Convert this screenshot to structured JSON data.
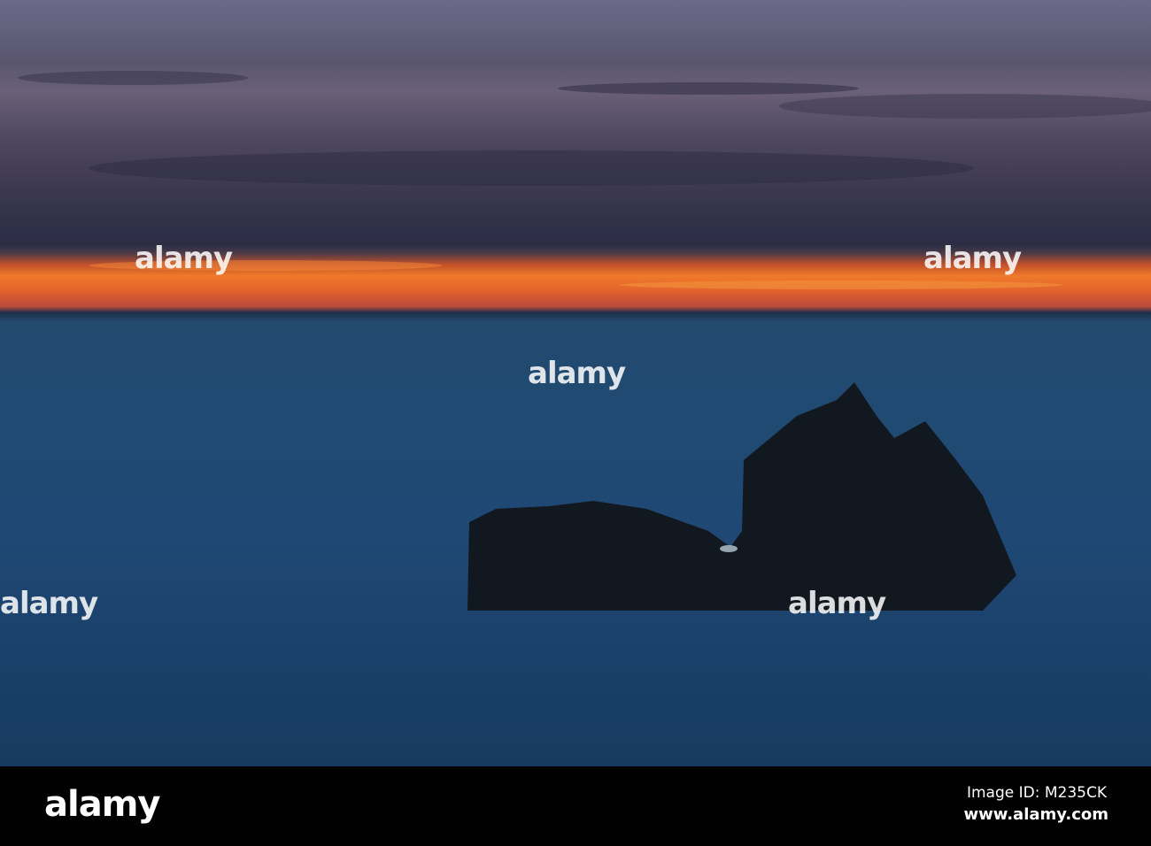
{
  "watermark": {
    "text": "alamy"
  },
  "footer": {
    "logo": "alamy",
    "image_id": "Image ID: M235CK",
    "url": "www.alamy.com"
  }
}
